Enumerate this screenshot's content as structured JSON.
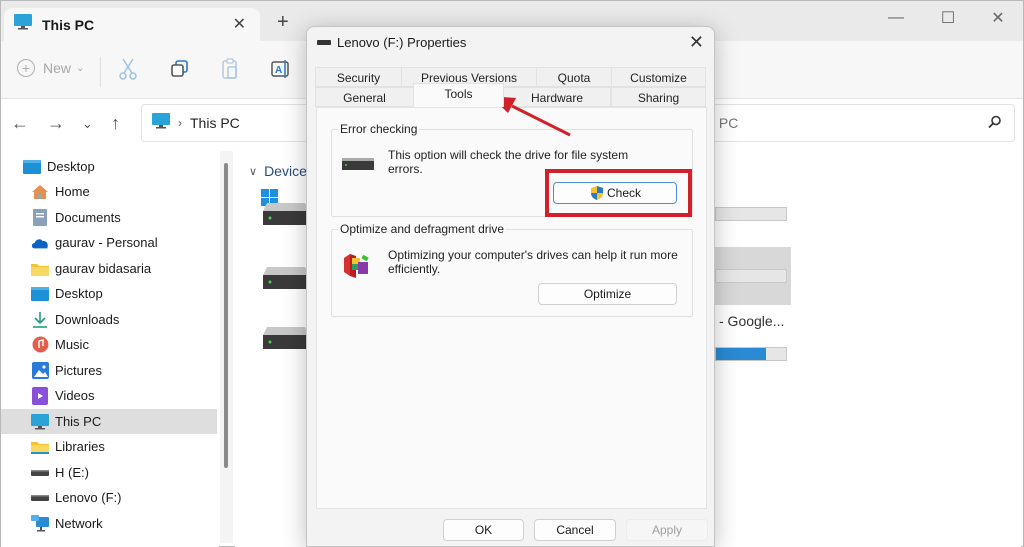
{
  "explorer": {
    "tab_title": "This PC",
    "toolbar": {
      "new_label": "New"
    },
    "breadcrumb": {
      "location": "This PC"
    },
    "search": {
      "placeholder_visible": "s PC"
    },
    "sidebar": {
      "items": [
        {
          "label": "Desktop",
          "icon": "desktop-icon"
        },
        {
          "label": "Home",
          "icon": "home-icon"
        },
        {
          "label": "Documents",
          "icon": "documents-icon"
        },
        {
          "label": "gaurav - Personal",
          "icon": "onedrive-icon"
        },
        {
          "label": "gaurav bidasaria",
          "icon": "folder-icon"
        },
        {
          "label": "Desktop",
          "icon": "desktop-icon"
        },
        {
          "label": "Downloads",
          "icon": "downloads-icon"
        },
        {
          "label": "Music",
          "icon": "music-icon"
        },
        {
          "label": "Pictures",
          "icon": "pictures-icon"
        },
        {
          "label": "Videos",
          "icon": "videos-icon"
        },
        {
          "label": "This PC",
          "icon": "this-pc-icon",
          "selected": true
        },
        {
          "label": "Libraries",
          "icon": "libraries-icon"
        },
        {
          "label": "H (E:)",
          "icon": "drive-icon"
        },
        {
          "label": "Lenovo (F:)",
          "icon": "drive-icon"
        },
        {
          "label": "Network",
          "icon": "network-icon"
        }
      ]
    },
    "content": {
      "section_header": "Devices",
      "partial_drive_name": "- Google...",
      "drive_usage": [
        0.0,
        0.0,
        0.72
      ]
    }
  },
  "dialog": {
    "title": "Lenovo (F:) Properties",
    "tabs_row1": [
      "Security",
      "Previous Versions",
      "Quota",
      "Customize"
    ],
    "tabs_row2": [
      "General",
      "Tools",
      "Hardware",
      "Sharing"
    ],
    "active_tab": "Tools",
    "error_checking": {
      "label": "Error checking",
      "text_line1": "This option will check the drive for file system",
      "text_line2": "errors.",
      "button": "Check"
    },
    "optimize": {
      "label": "Optimize and defragment drive",
      "text_line1": "Optimizing your computer's drives can help it run more",
      "text_line2": "efficiently.",
      "button": "Optimize"
    },
    "footer": {
      "ok": "OK",
      "cancel": "Cancel",
      "apply": "Apply"
    }
  },
  "annotation": {
    "highlight_color": "#d2202a",
    "arrow_color": "#d2202a"
  }
}
